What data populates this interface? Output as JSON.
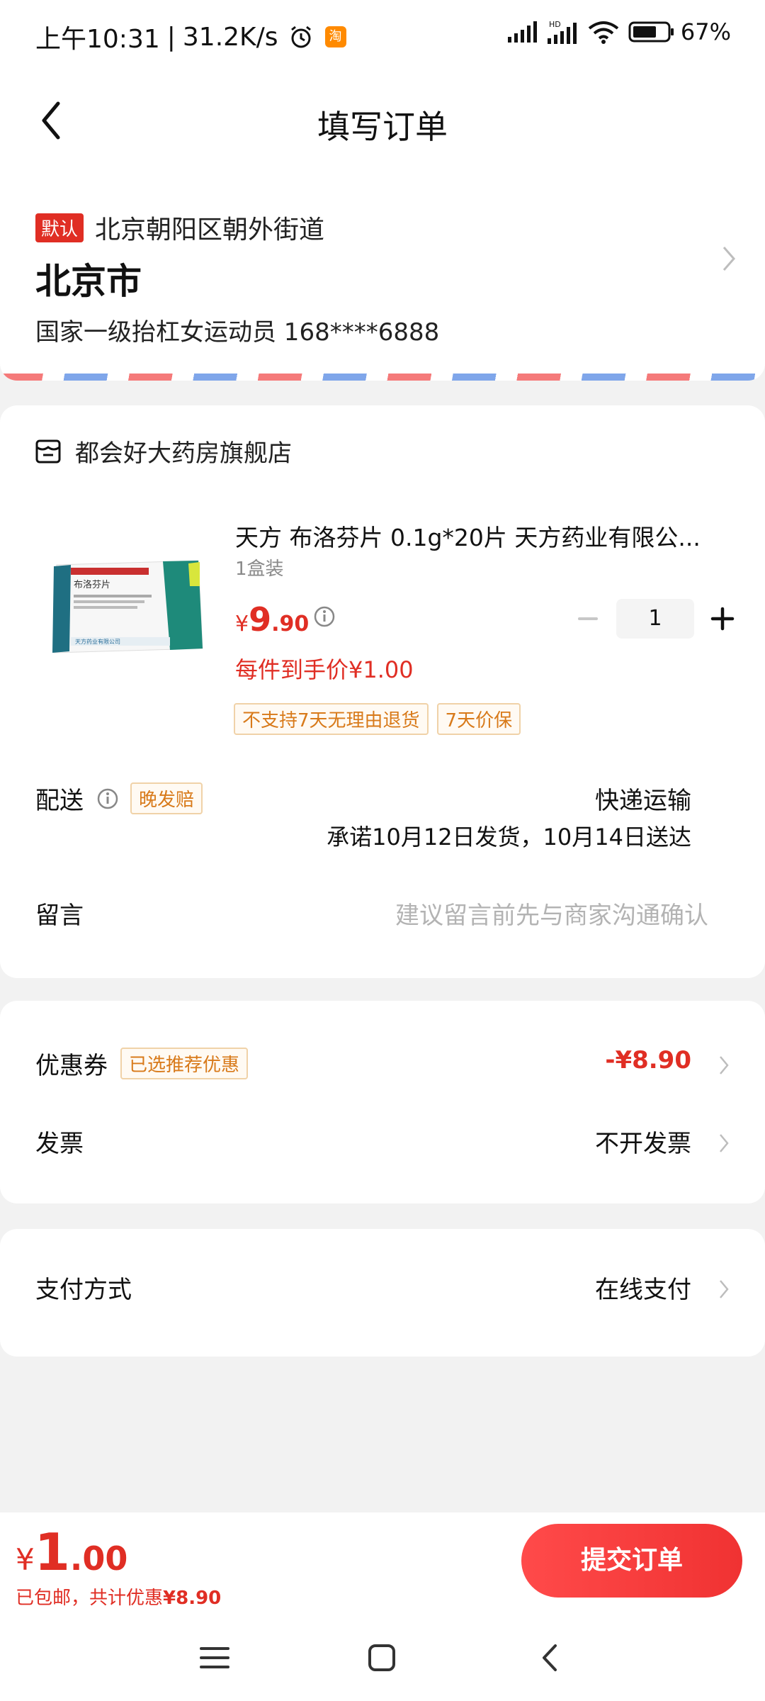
{
  "status_bar": {
    "time": "上午10:31",
    "speed": "31.2K/s",
    "app_badge": "淘",
    "battery": "67%"
  },
  "header": {
    "title": "填写订单"
  },
  "address": {
    "default_tag": "默认",
    "street": "北京朝阳区朝外街道",
    "city": "北京市",
    "contact": "国家一级抬杠女运动员  168****6888"
  },
  "store": {
    "name": "都会好大药房旗舰店",
    "product": {
      "name": "天方 布洛芬片 0.1g*20片 天方药业有限公...",
      "spec": "1盒装",
      "price_currency": "¥",
      "price_int": "9",
      "price_dec": ".90",
      "quantity": "1",
      "unit_price": "每件到手价¥1.00",
      "tags": [
        "不支持7天无理由退货",
        "7天价保"
      ]
    },
    "delivery": {
      "label": "配送",
      "badge": "晚发赔",
      "method": "快递运输",
      "promise": "承诺10月12日发货，10月14日送达"
    },
    "message": {
      "label": "留言",
      "placeholder": "建议留言前先与商家沟通确认"
    }
  },
  "coupon": {
    "label": "优惠券",
    "badge": "已选推荐优惠",
    "value": "-¥8.90"
  },
  "invoice": {
    "label": "发票",
    "value": "不开发票"
  },
  "payment": {
    "label": "支付方式",
    "value": "在线支付"
  },
  "bottom": {
    "currency": "¥",
    "total_int": "1",
    "total_dec": ".00",
    "shipping": "已包邮，共计优惠",
    "discount": "¥8.90",
    "submit_label": "提交订单"
  },
  "colors": {
    "accent": "#e02e24",
    "tag_border": "#f0d2a8",
    "tag_text": "#d87a1a"
  }
}
